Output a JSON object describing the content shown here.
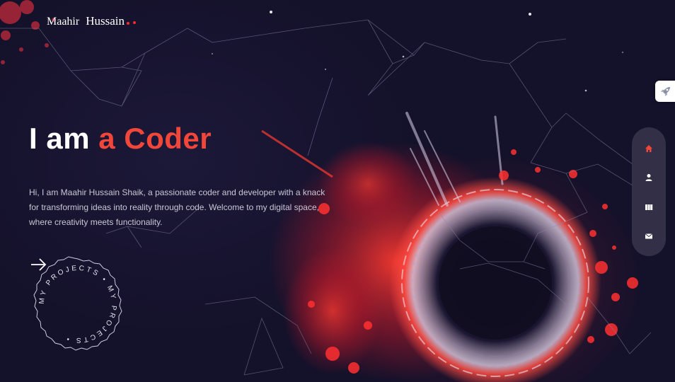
{
  "brand": {
    "first_name": "Maahir",
    "last_name": "Hussain",
    "dot_color": "#ff2a2a"
  },
  "hero": {
    "title_prefix": "I am",
    "title_accent": "a Coder",
    "accent_color": "#f0473a",
    "intro": "Hi, I am Maahir Hussain Shaik, a passionate coder and developer with a knack for transforming ideas into reality through code. Welcome to my digital space, where creativity meets functionality."
  },
  "projects_button": {
    "circle_text": "MY PROJECTS • MY PROJECTS •",
    "icon": "arrow-right-icon"
  },
  "floating_button": {
    "icon": "rocket-icon"
  },
  "side_nav": {
    "items": [
      {
        "icon": "home-icon",
        "active": true
      },
      {
        "icon": "user-icon",
        "active": false
      },
      {
        "icon": "portfolio-icon",
        "active": false
      },
      {
        "icon": "mail-icon",
        "active": false
      }
    ]
  }
}
